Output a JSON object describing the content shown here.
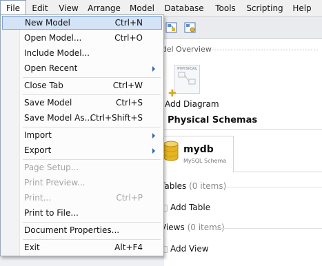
{
  "menubar": {
    "items": [
      "File",
      "Edit",
      "View",
      "Arrange",
      "Model",
      "Database",
      "Tools",
      "Scripting",
      "Help"
    ]
  },
  "workspace": {
    "overview_title": "odel Overview",
    "add_diagram": "Add Diagram",
    "diagram_thumb_tag": "PHYSICAL",
    "section_title": "Physical Schemas",
    "schema_name": "mydb",
    "schema_type": "MySQL Schema",
    "tables_label": "Tables",
    "tables_count": "(0 items)",
    "add_table": "Add Table",
    "views_label": "Views",
    "views_count": "(0 items)",
    "add_view": "Add View"
  },
  "file_menu": {
    "items": [
      {
        "label": "New Model",
        "shortcut": "Ctrl+N"
      },
      {
        "label": "Open Model...",
        "shortcut": "Ctrl+O"
      },
      {
        "label": "Include Model...",
        "shortcut": ""
      },
      {
        "label": "Open Recent",
        "shortcut": ""
      },
      {
        "label": "Close Tab",
        "shortcut": "Ctrl+W"
      },
      {
        "label": "Save Model",
        "shortcut": "Ctrl+S"
      },
      {
        "label": "Save Model As...",
        "shortcut": "Ctrl+Shift+S"
      },
      {
        "label": "Import",
        "shortcut": ""
      },
      {
        "label": "Export",
        "shortcut": ""
      },
      {
        "label": "Page Setup...",
        "shortcut": ""
      },
      {
        "label": "Print Preview...",
        "shortcut": ""
      },
      {
        "label": "Print...",
        "shortcut": "Ctrl+P"
      },
      {
        "label": "Print to File...",
        "shortcut": ""
      },
      {
        "label": "Document Properties...",
        "shortcut": ""
      },
      {
        "label": "Exit",
        "shortcut": "Alt+F4"
      }
    ]
  },
  "icons": {
    "toolbar_button_1": "diagram-grid-icon",
    "toolbar_button_2": "diagram-settings-icon",
    "add_diagram": "add-diagram-icon",
    "schema": "database-icon",
    "submenu": "chevron-right-icon"
  },
  "colors": {
    "menu_highlight": "#d4e3f6",
    "menu_highlight_border": "#7ea3cf",
    "submenu_arrow": "#2f64b5",
    "disabled_text": "#a3a3a3",
    "database_icon": "#e6b422"
  }
}
